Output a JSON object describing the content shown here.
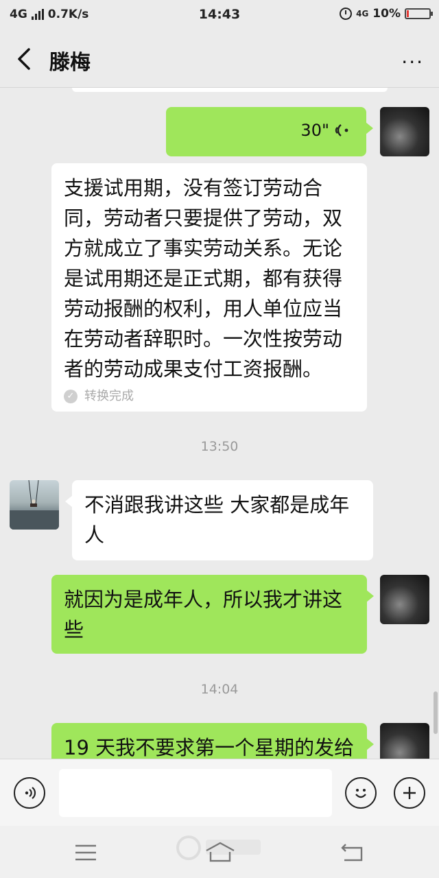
{
  "status_bar": {
    "network": "4G",
    "speed": "0.7K/s",
    "time": "14:43",
    "network_right": "4G",
    "battery": "10%",
    "battery_level": 0.1
  },
  "header": {
    "title": "滕梅",
    "more": "···"
  },
  "messages": {
    "voice": {
      "duration": "30\""
    },
    "transcript": {
      "lines": [
        "支援试用期，没有签订劳动合",
        "同，劳动者只要提供了劳动，双",
        "方就成立了事实劳动关系。无论",
        "是试用期还是正式期，都有获得",
        "劳动报酬的权利，用人单位应当",
        "在劳动者辞职时。一次性按劳动",
        "者的劳动成果支付工资报酬。"
      ],
      "status": "转换完成"
    },
    "time_1": "13:50",
    "other_msg": {
      "lines": [
        "不消跟我讲这些  大家都是成年",
        "人"
      ]
    },
    "my_msg_1": {
      "lines": [
        "就因为是成年人，所以我才讲这",
        "些"
      ]
    },
    "time_2": "14:04",
    "my_msg_2": {
      "lines": [
        "19 天我不要求第一个星期的发给"
      ]
    }
  },
  "input_bar": {
    "placeholder": ""
  },
  "colors": {
    "my_bubble": "#9fe65b",
    "other_bubble": "#ffffff",
    "background": "#ebebeb"
  }
}
